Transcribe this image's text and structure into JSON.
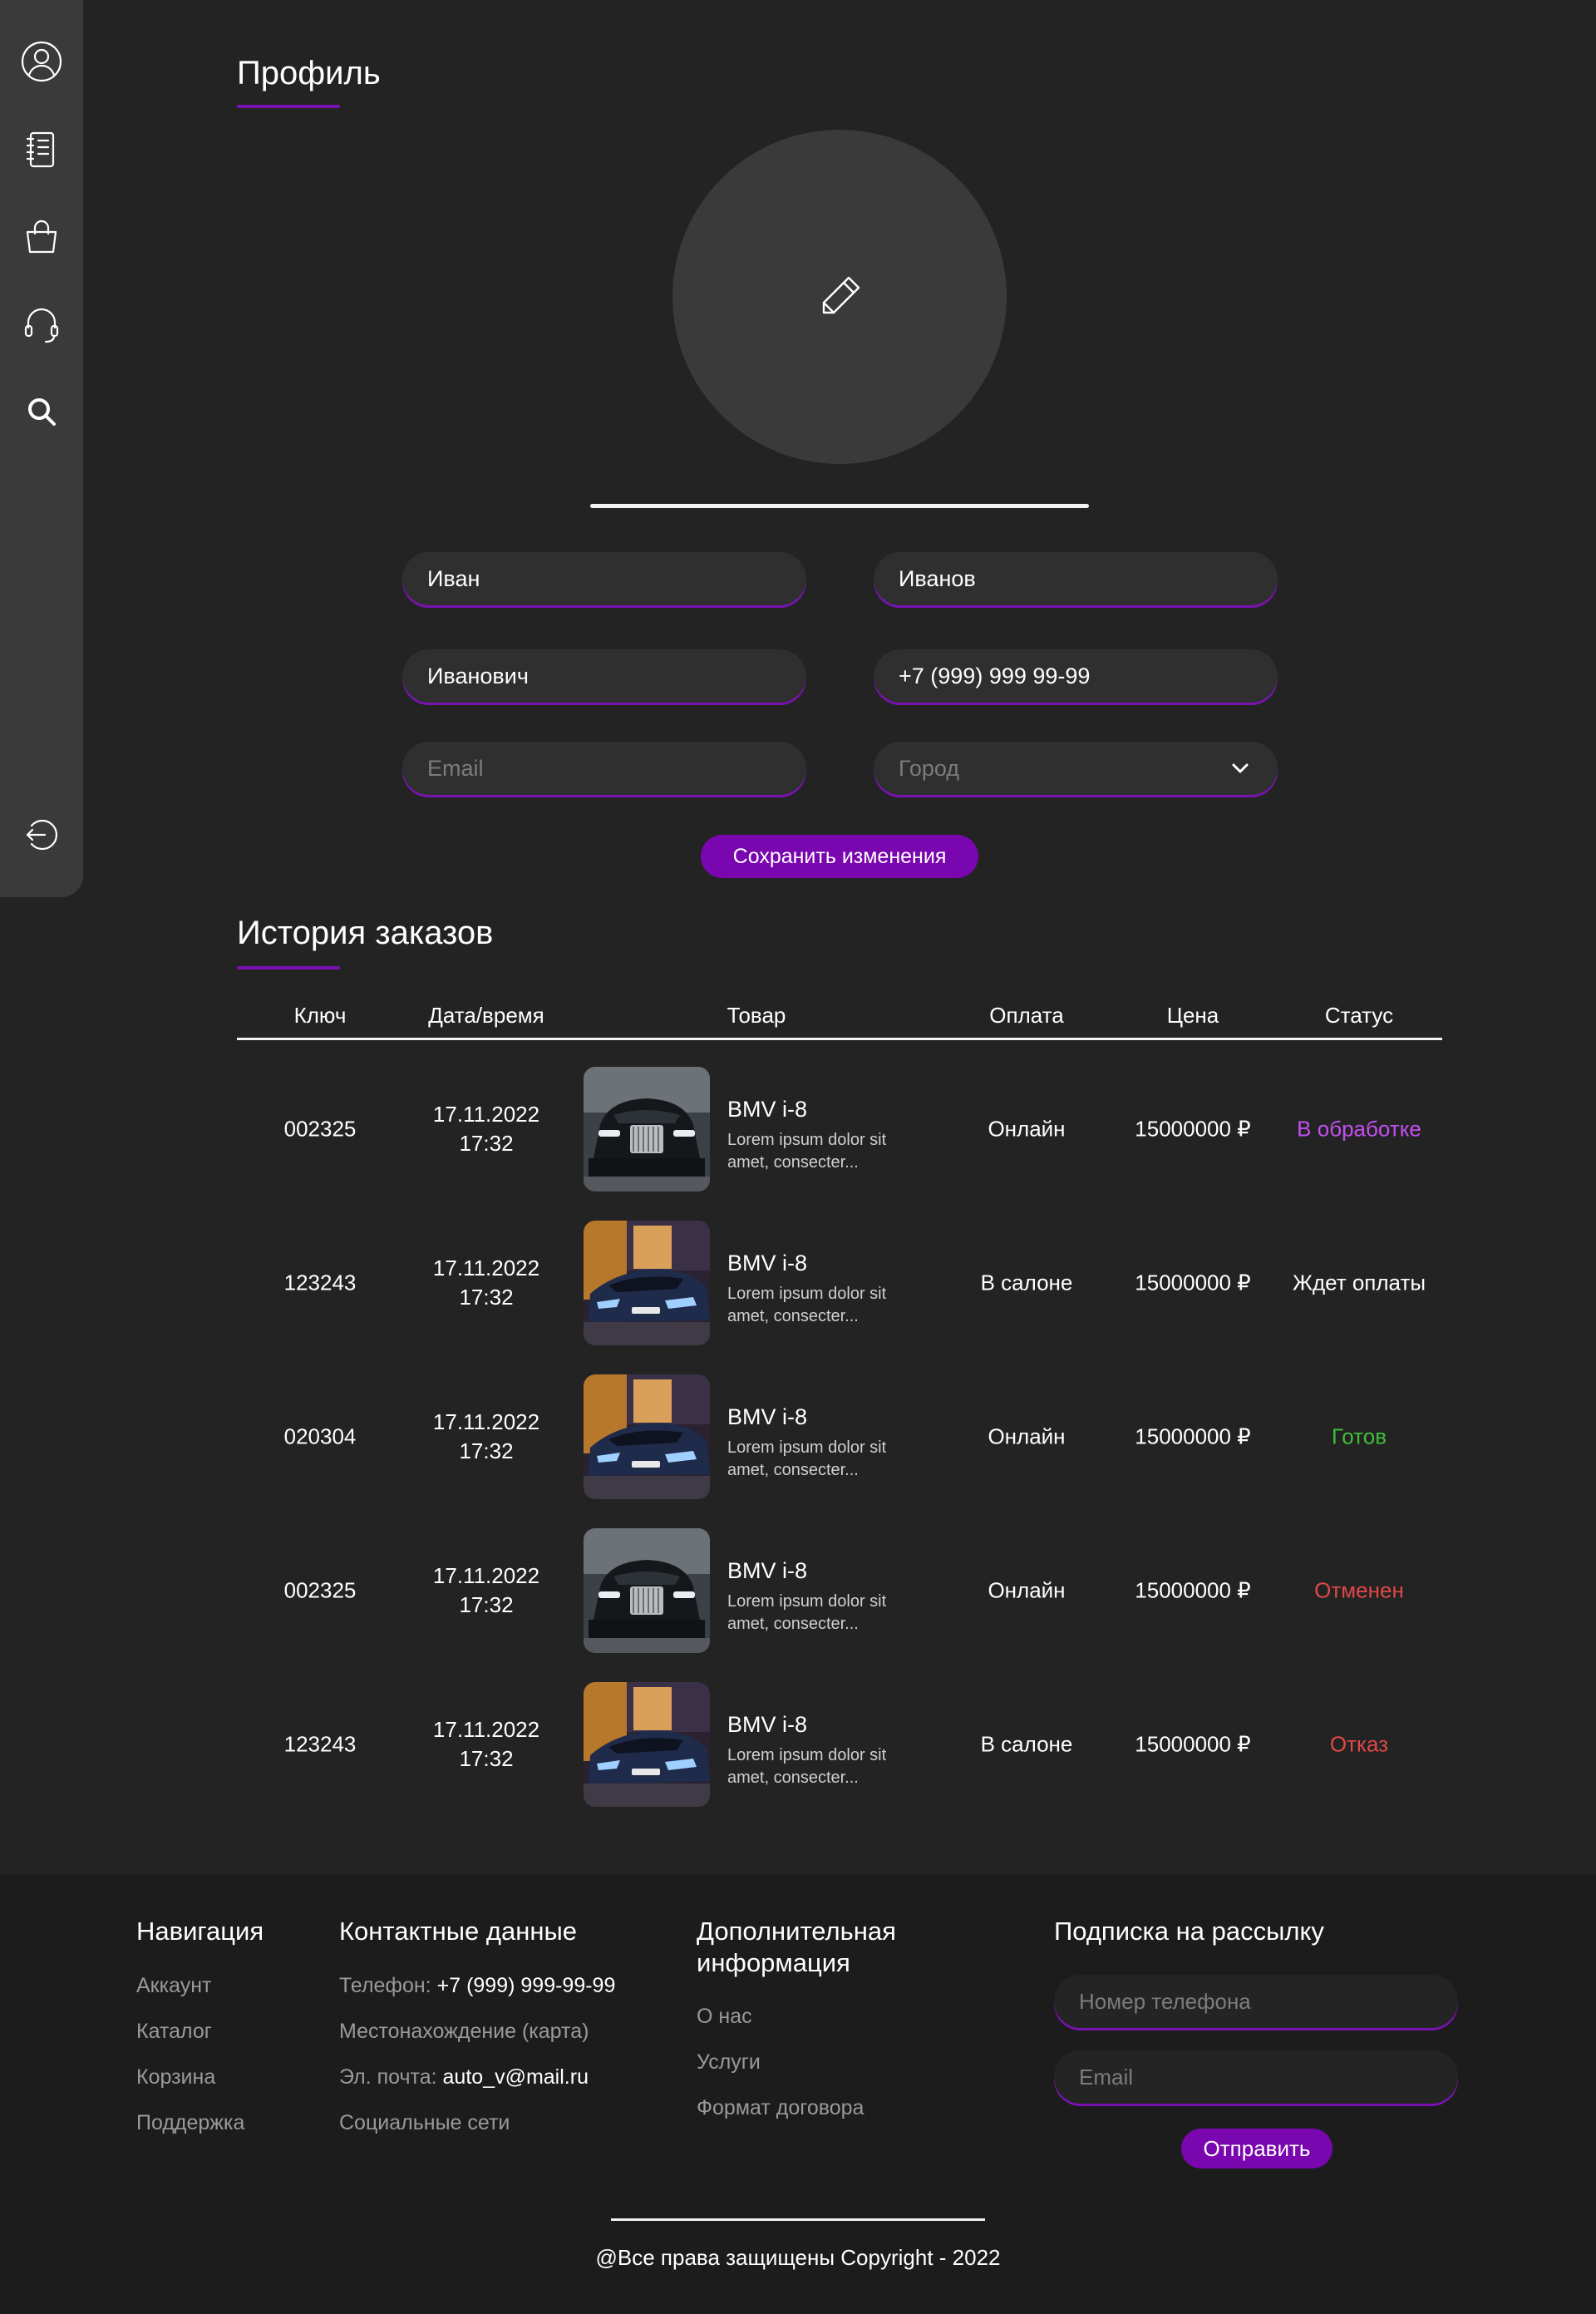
{
  "sidebar": {
    "icons": [
      "user-icon",
      "notebook-icon",
      "shopping-bag-icon",
      "headset-icon",
      "search-icon",
      "logout-icon"
    ]
  },
  "profile": {
    "title": "Профиль",
    "first_name": "Иван",
    "last_name": "Иванов",
    "patronymic": "Иванович",
    "phone": "+7 (999) 999 99-99",
    "email_placeholder": "Email",
    "city_placeholder": "Город",
    "save_label": "Сохранить изменения"
  },
  "orders": {
    "title": "История заказов",
    "columns": [
      "Ключ",
      "Дата/время",
      "Товар",
      "Оплата",
      "Цена",
      "Статус"
    ],
    "rows": [
      {
        "key": "002325",
        "date": "17.11.2022",
        "time": "17:32",
        "product": "BMV i-8",
        "desc": "Lorem ipsum dolor sit amet, consecter...",
        "payment": "Онлайн",
        "price": "15000000 ₽",
        "status": "В обработке",
        "image": "car-front"
      },
      {
        "key": "123243",
        "date": "17.11.2022",
        "time": "17:32",
        "product": "BMV i-8",
        "desc": "Lorem ipsum dolor sit amet, consecter...",
        "payment": "В салоне",
        "price": "15000000 ₽",
        "status": "Ждет оплаты",
        "image": "car-blue"
      },
      {
        "key": "020304",
        "date": "17.11.2022",
        "time": "17:32",
        "product": "BMV i-8",
        "desc": "Lorem ipsum dolor sit amet, consecter...",
        "payment": "Онлайн",
        "price": "15000000 ₽",
        "status": "Готов",
        "image": "car-blue"
      },
      {
        "key": "002325",
        "date": "17.11.2022",
        "time": "17:32",
        "product": "BMV i-8",
        "desc": "Lorem ipsum dolor sit amet, consecter...",
        "payment": "Онлайн",
        "price": "15000000 ₽",
        "status": "Отменен",
        "image": "car-front"
      },
      {
        "key": "123243",
        "date": "17.11.2022",
        "time": "17:32",
        "product": "BMV i-8",
        "desc": "Lorem ipsum dolor sit amet, consecter...",
        "payment": "В салоне",
        "price": "15000000 ₽",
        "status": "Отказ",
        "image": "car-blue"
      }
    ]
  },
  "status_colors": {
    "В обработке": "#c44ff0",
    "Ждет оплаты": "#ffffff",
    "Готов": "#3fbf3a",
    "Отменен": "#e04848",
    "Отказ": "#e04848"
  },
  "colors": {
    "accent": "#7a06b0",
    "background": "#232323",
    "sidebar": "#3a3a3a"
  },
  "footer": {
    "nav": {
      "title": "Навигация",
      "links": [
        "Аккаунт",
        "Каталог",
        "Корзина",
        "Поддержка"
      ]
    },
    "contacts": {
      "title": "Контактные данные",
      "phone_label": "Телефон:",
      "phone_value": "+7 (999) 999-99-99",
      "location": "Местонахождение (карта)",
      "email_label": "Эл. почта:",
      "email_value": "auto_v@mail.ru",
      "social": "Социальные сети"
    },
    "info": {
      "title_line1": "Дополнительная",
      "title_line2": "информация",
      "links": [
        "О нас",
        "Услуги",
        "Формат договора"
      ]
    },
    "subscribe": {
      "title": "Подписка на рассылку",
      "phone_placeholder": "Номер телефона",
      "email_placeholder": "Email",
      "send_label": "Отправить"
    },
    "copyright": "@Все права защищены Copyright - 2022"
  }
}
